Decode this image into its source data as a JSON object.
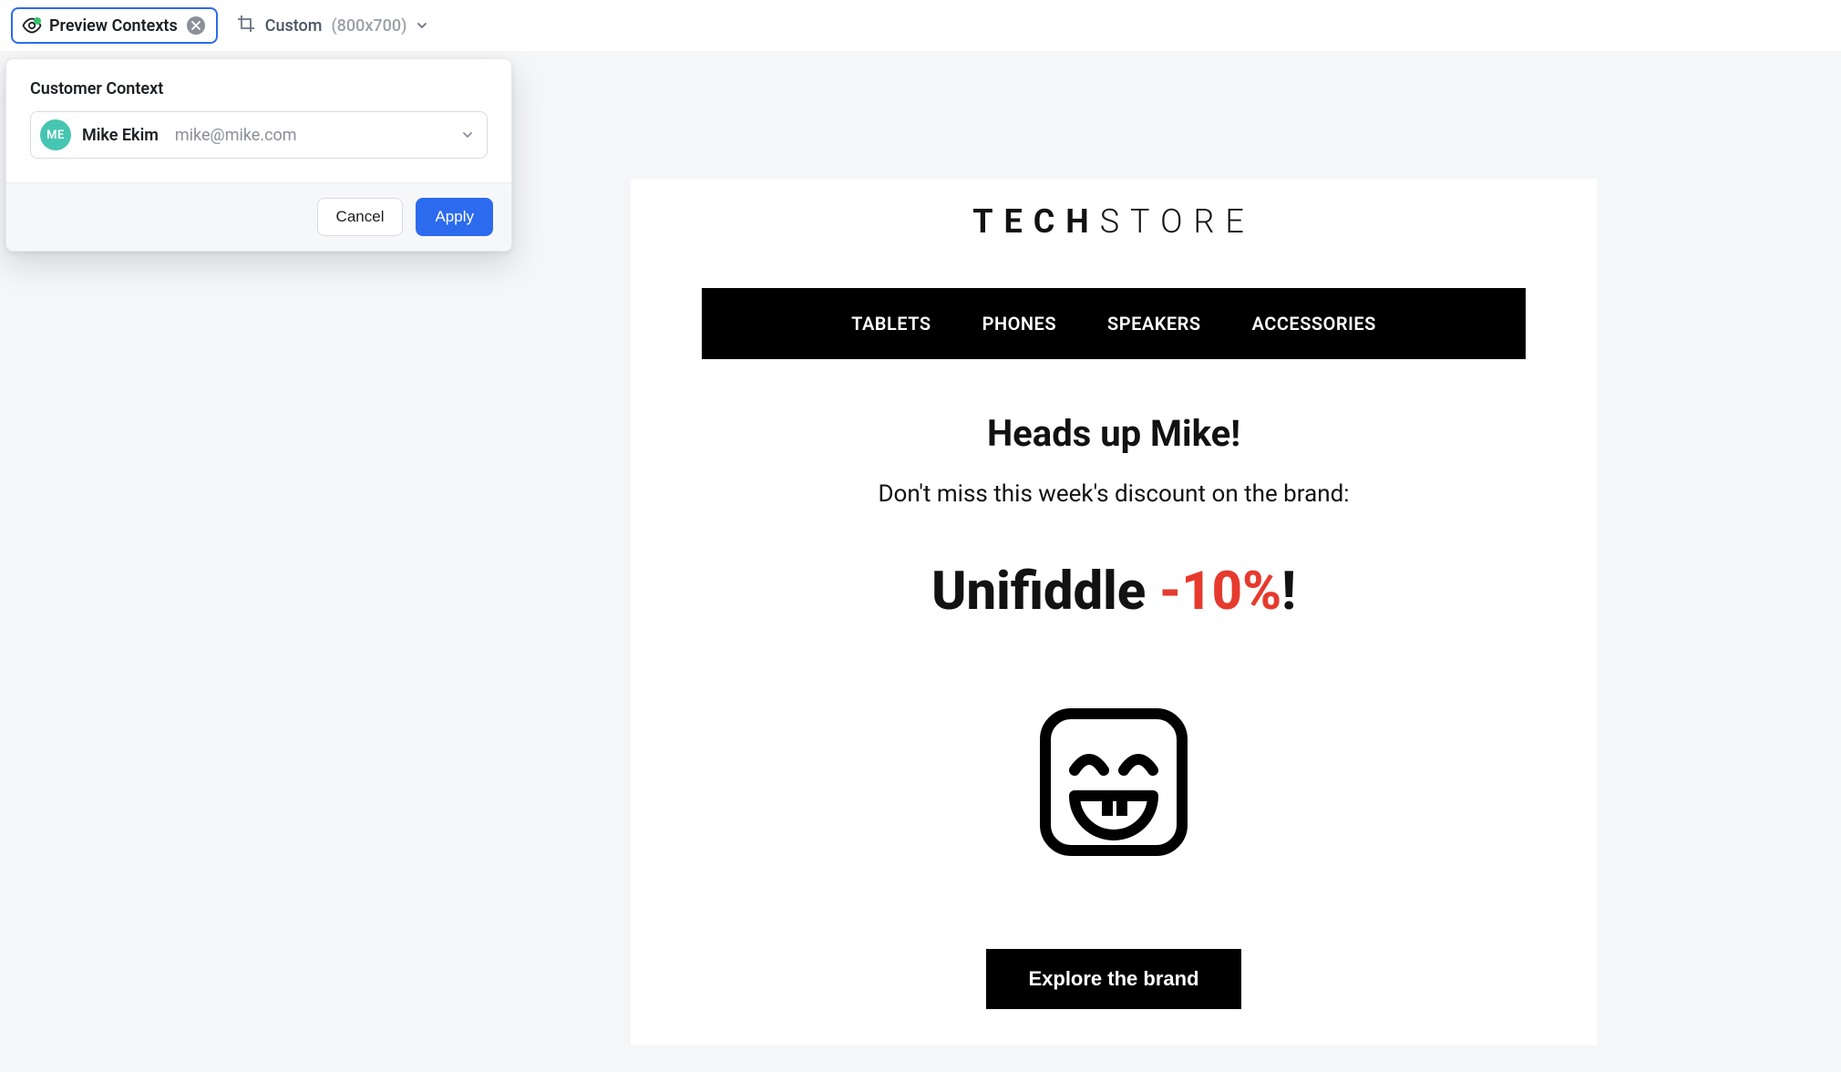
{
  "toolbar": {
    "preview_label": "Preview Contexts",
    "size_label": "Custom",
    "size_dims": "(800x700)"
  },
  "context_popover": {
    "title": "Customer Context",
    "avatar_initials": "ME",
    "customer_name": "Mike Ekim",
    "customer_email": "mike@mike.com",
    "cancel_label": "Cancel",
    "apply_label": "Apply"
  },
  "email": {
    "brand_bold": "TECH",
    "brand_light": "STORE",
    "nav": [
      "TABLETS",
      "PHONES",
      "SPEAKERS",
      "ACCESSORIES"
    ],
    "headline": "Heads up Mike!",
    "subhead": "Don't miss this week's discount on the brand:",
    "promo_brand": "Unifiddle ",
    "promo_discount": "-10%",
    "promo_suffix": "!",
    "cta_label": "Explore the brand"
  },
  "colors": {
    "primary": "#2c6bed",
    "discount": "#e63a2e",
    "avatar": "#46c6b2"
  }
}
